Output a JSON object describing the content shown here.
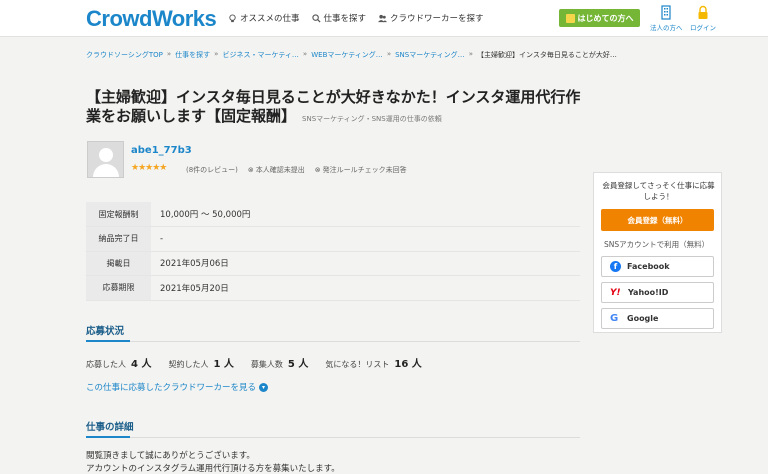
{
  "header": {
    "logo": "CrowdWorks",
    "nav": [
      {
        "label": "オススメの仕事",
        "icon": "bulb-icon"
      },
      {
        "label": "仕事を探す",
        "icon": "search-icon"
      },
      {
        "label": "クラウドワーカーを探す",
        "icon": "users-icon"
      }
    ],
    "start_button": "はじめての方へ",
    "corporate_link": "法人の方へ",
    "login_link": "ログイン"
  },
  "breadcrumb": {
    "items": [
      "クラウドソーシングTOP",
      "仕事を探す",
      "ビジネス・マーケティ…",
      "WEBマーケティング…",
      "SNSマーケティング…"
    ],
    "current": "【主婦歓迎】インスタ毎日見ることが大好…"
  },
  "job": {
    "title": "【主婦歓迎】インスタ毎日見ることが大好きなかた！インスタ運用代行作業をお願いします【固定報酬】",
    "subtitle": "SNSマーケティング・SNS運用の仕事の依頼",
    "client": {
      "name": "abe1_77b3",
      "stars": "★★★★★",
      "reviews": "(8件のレビュー)",
      "identity": "本人確認未提出",
      "rule_check": "発注ルールチェック未回答"
    },
    "info": [
      {
        "label": "固定報酬制",
        "value": "10,000円 〜 50,000円"
      },
      {
        "label": "納品完了日",
        "value": "-"
      },
      {
        "label": "掲載日",
        "value": "2021年05月06日"
      },
      {
        "label": "応募期限",
        "value": "2021年05月20日"
      }
    ]
  },
  "status": {
    "title": "応募状況",
    "items": [
      {
        "label": "応募した人",
        "value": "4 人"
      },
      {
        "label": "契約した人",
        "value": "1 人"
      },
      {
        "label": "募集人数",
        "value": "5 人"
      },
      {
        "label": "気になる！リスト",
        "value": "16 人"
      }
    ],
    "applicants_link": "この仕事に応募したクラウドワーカーを見る"
  },
  "details": {
    "title": "仕事の詳細",
    "lines": [
      "閲覧頂きまして誠にありがとうございます。",
      "アカウントのインスタグラム運用代行頂ける方を募集いたします。"
    ]
  },
  "sidebar": {
    "message": "会員登録してさっそく仕事に応募しよう！",
    "register_button": "会員登録（無料）",
    "sns_label": "SNSアカウントで利用（無料）",
    "facebook": "Facebook",
    "yahoo": "Yahoo!ID",
    "google": "Google"
  },
  "colors": {
    "brand_blue": "#1b86c9",
    "register_orange": "#f08300",
    "start_green": "#75b636",
    "star": "#f5a623"
  }
}
